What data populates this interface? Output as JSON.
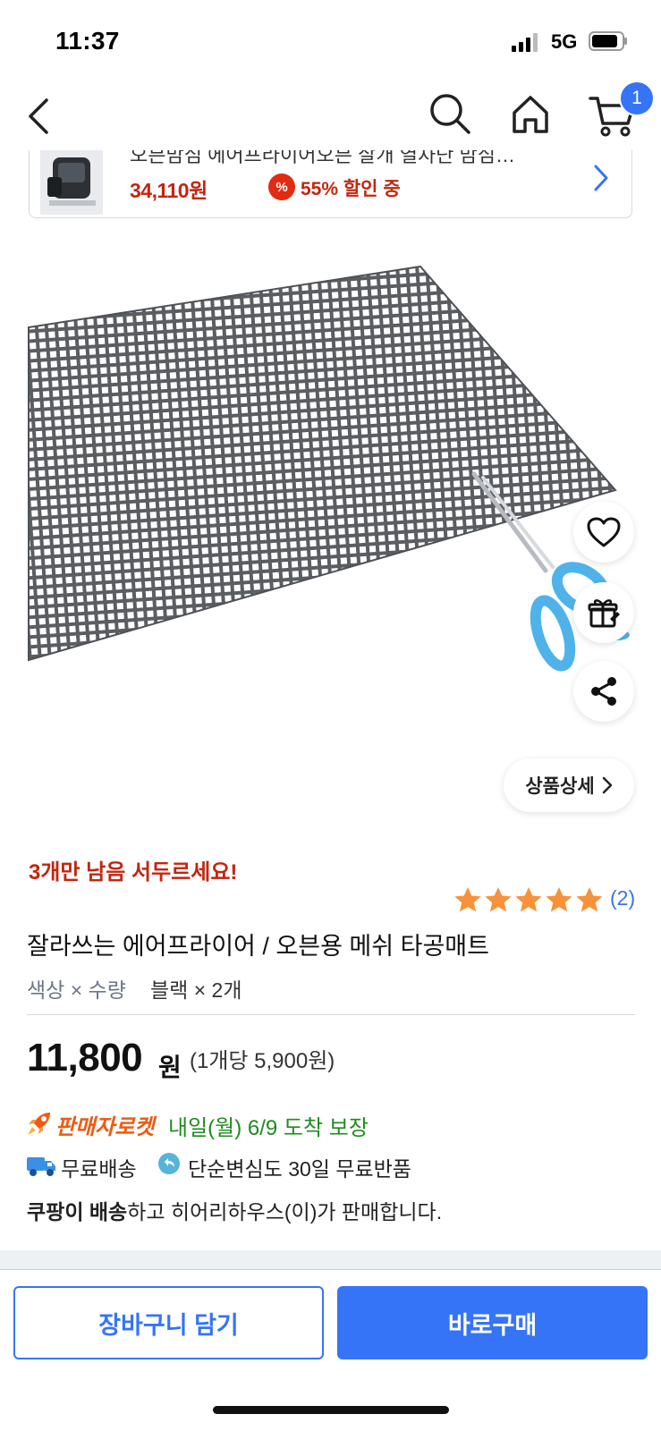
{
  "status_bar": {
    "time": "11:37",
    "network": "5G"
  },
  "nav": {
    "icons": [
      "back-icon",
      "search-icon",
      "home-icon",
      "cart-icon"
    ],
    "cart_badge": "1"
  },
  "linked_item": {
    "title": "오븐맘심 에어프라이어오븐 살개 열차단 맘심…",
    "price": "34,110원",
    "discount_badge": "%",
    "discount": "55% 할인 중"
  },
  "product": {
    "stock_warning": "3개만 남음 서두르세요!",
    "rating_stars": 5,
    "review_count": "(2)",
    "name": "잘라쓰는 에어프라이어 / 오븐용 메쉬 타공매트",
    "option_label": "색상 × 수량",
    "option_value": "블랙 × 2개",
    "price": "11,800",
    "currency": "원",
    "unit_price": "(1개당 5,900원)",
    "rocket_label": "판매자로켓",
    "arrival": "내일(월) 6/9 도착 보장",
    "free_shipping": "무료배송",
    "return_policy": "단순변심도 30일 무료반품",
    "seller_prefix": "쿠팡이 배송",
    "seller_suffix": "하고 히어리하우스(이)가 판매합니다."
  },
  "actions": {
    "detail_button": "상품상세",
    "add_to_cart": "장바구니 담기",
    "buy_now": "바로구매"
  },
  "colors": {
    "accent": "#3574f6",
    "sale_red": "#c2260f",
    "rocket_orange": "#ef5a12",
    "arrival_green": "#1d8c1d",
    "star_orange": "#f7923b"
  }
}
